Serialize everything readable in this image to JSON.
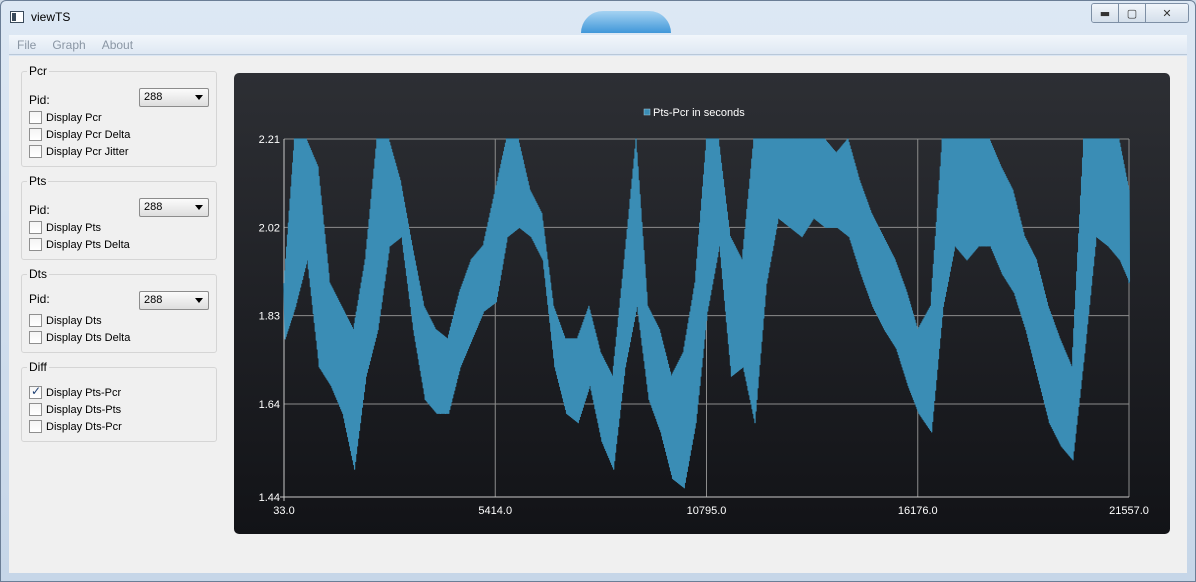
{
  "window": {
    "title": "viewTS",
    "minimize_glyph": "▬",
    "maximize_glyph": "▢",
    "close_glyph": "✕"
  },
  "menu": [
    "File",
    "Graph",
    "About"
  ],
  "groups": {
    "pcr": {
      "title": "Pcr",
      "pid_label": "Pid:",
      "pid_value": "288",
      "checkboxes": [
        {
          "label": "Display Pcr",
          "checked": false
        },
        {
          "label": "Display Pcr Delta",
          "checked": false
        },
        {
          "label": "Display Pcr Jitter",
          "checked": false
        }
      ]
    },
    "pts": {
      "title": "Pts",
      "pid_label": "Pid:",
      "pid_value": "288",
      "checkboxes": [
        {
          "label": "Display Pts",
          "checked": false
        },
        {
          "label": "Display Pts Delta",
          "checked": false
        }
      ]
    },
    "dts": {
      "title": "Dts",
      "pid_label": "Pid:",
      "pid_value": "288",
      "checkboxes": [
        {
          "label": "Display Dts",
          "checked": false
        },
        {
          "label": "Display Dts Delta",
          "checked": false
        }
      ]
    },
    "diff": {
      "title": "Diff",
      "checkboxes": [
        {
          "label": "Display Pts-Pcr",
          "checked": true
        },
        {
          "label": "Display Dts-Pts",
          "checked": false
        },
        {
          "label": "Display Dts-Pcr",
          "checked": false
        }
      ]
    }
  },
  "chart_data": {
    "type": "line",
    "title": "",
    "xlabel": "",
    "ylabel": "",
    "legend": {
      "placement": "top-center",
      "entries": [
        "Pts-Pcr in seconds"
      ]
    },
    "grid": true,
    "xlim": [
      33.0,
      21557.0
    ],
    "ylim": [
      1.44,
      2.21
    ],
    "x_ticks": [
      "33.0",
      "5414.0",
      "10795.0",
      "16176.0",
      "21557.0"
    ],
    "y_ticks": [
      "1.44",
      "1.64",
      "1.83",
      "2.02",
      "2.21"
    ],
    "colors": {
      "series": "#3a8db5",
      "grid": "#8c8c8c",
      "axis": "#c8c8c8",
      "text": "#ffffff"
    },
    "series": [
      {
        "name": "Pts-Pcr in seconds",
        "x": [
          33,
          300,
          600,
          900,
          1200,
          1500,
          1800,
          2100,
          2400,
          2700,
          3000,
          3300,
          3600,
          3900,
          4200,
          4500,
          4800,
          5100,
          5414,
          5700,
          6000,
          6300,
          6600,
          6900,
          7200,
          7500,
          7800,
          8100,
          8400,
          8700,
          9000,
          9300,
          9600,
          9900,
          10200,
          10500,
          10795,
          11100,
          11400,
          11700,
          12000,
          12300,
          12600,
          12900,
          13200,
          13500,
          13800,
          14100,
          14400,
          14700,
          15000,
          15300,
          15600,
          15900,
          16176,
          16500,
          16800,
          17100,
          17400,
          17700,
          18000,
          18300,
          18600,
          18900,
          19200,
          19500,
          19800,
          20100,
          20400,
          20700,
          21000,
          21300,
          21557
        ],
        "y_min": [
          1.78,
          1.85,
          1.95,
          1.72,
          1.68,
          1.62,
          1.5,
          1.7,
          1.8,
          1.98,
          2.0,
          1.8,
          1.65,
          1.62,
          1.62,
          1.72,
          1.78,
          1.84,
          1.86,
          2.0,
          2.02,
          2.0,
          1.95,
          1.72,
          1.62,
          1.6,
          1.68,
          1.56,
          1.5,
          1.72,
          1.85,
          1.65,
          1.58,
          1.48,
          1.46,
          1.6,
          1.84,
          1.98,
          1.7,
          1.72,
          1.6,
          1.9,
          2.04,
          2.02,
          2.0,
          2.04,
          2.02,
          2.02,
          2.0,
          1.92,
          1.85,
          1.8,
          1.76,
          1.68,
          1.62,
          1.58,
          1.85,
          1.98,
          1.95,
          1.98,
          1.98,
          1.92,
          1.88,
          1.8,
          1.7,
          1.6,
          1.55,
          1.52,
          1.75,
          2.0,
          1.98,
          1.95,
          1.9
        ],
        "y_max": [
          1.9,
          2.21,
          2.21,
          2.15,
          1.9,
          1.85,
          1.8,
          1.95,
          2.21,
          2.21,
          2.12,
          1.98,
          1.85,
          1.8,
          1.78,
          1.88,
          1.95,
          1.98,
          2.1,
          2.21,
          2.21,
          2.1,
          2.05,
          1.85,
          1.78,
          1.78,
          1.85,
          1.75,
          1.7,
          1.95,
          2.21,
          1.85,
          1.8,
          1.7,
          1.75,
          1.9,
          2.21,
          2.21,
          2.0,
          1.95,
          2.21,
          2.21,
          2.21,
          2.21,
          2.21,
          2.21,
          2.21,
          2.18,
          2.21,
          2.12,
          2.05,
          2.0,
          1.95,
          1.88,
          1.8,
          1.85,
          2.21,
          2.21,
          2.21,
          2.21,
          2.21,
          2.15,
          2.1,
          2.0,
          1.95,
          1.85,
          1.78,
          1.72,
          2.21,
          2.21,
          2.21,
          2.21,
          2.1
        ]
      }
    ]
  }
}
